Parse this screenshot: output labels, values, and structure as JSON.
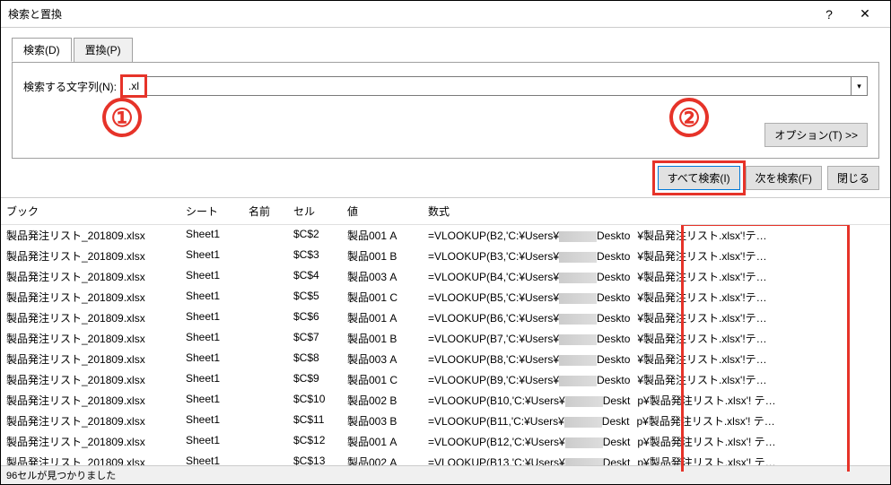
{
  "title": "検索と置換",
  "help_icon": "?",
  "close_icon": "✕",
  "tabs": {
    "find": "検索(D)",
    "replace": "置換(P)"
  },
  "search_label": "検索する文字列(N):",
  "search_value": ".xl",
  "options_button": "オプション(T) >>",
  "buttons": {
    "find_all": "すべて検索(I)",
    "find_next": "次を検索(F)",
    "close": "閉じる"
  },
  "columns": {
    "book": "ブック",
    "sheet": "シート",
    "name": "名前",
    "cell": "セル",
    "value": "値",
    "formula": "数式"
  },
  "rows": [
    {
      "book": "製品発注リスト_201809.xlsx",
      "sheet": "Sheet1",
      "cell": "$C$2",
      "value": "製品001 A",
      "formula_prefix": "=VLOOKUP(B2,'C:¥Users¥",
      "formula_mid": "Deskto",
      "formula_suffix": "¥製品発注リスト.xlsx'!テ…"
    },
    {
      "book": "製品発注リスト_201809.xlsx",
      "sheet": "Sheet1",
      "cell": "$C$3",
      "value": "製品001 B",
      "formula_prefix": "=VLOOKUP(B3,'C:¥Users¥",
      "formula_mid": "Deskto",
      "formula_suffix": "¥製品発注リスト.xlsx'!テ…"
    },
    {
      "book": "製品発注リスト_201809.xlsx",
      "sheet": "Sheet1",
      "cell": "$C$4",
      "value": "製品003 A",
      "formula_prefix": "=VLOOKUP(B4,'C:¥Users¥",
      "formula_mid": "Deskto",
      "formula_suffix": "¥製品発注リスト.xlsx'!テ…"
    },
    {
      "book": "製品発注リスト_201809.xlsx",
      "sheet": "Sheet1",
      "cell": "$C$5",
      "value": "製品001 C",
      "formula_prefix": "=VLOOKUP(B5,'C:¥Users¥",
      "formula_mid": "Deskto",
      "formula_suffix": "¥製品発注リスト.xlsx'!テ…"
    },
    {
      "book": "製品発注リスト_201809.xlsx",
      "sheet": "Sheet1",
      "cell": "$C$6",
      "value": "製品001 A",
      "formula_prefix": "=VLOOKUP(B6,'C:¥Users¥",
      "formula_mid": "Deskto",
      "formula_suffix": "¥製品発注リスト.xlsx'!テ…"
    },
    {
      "book": "製品発注リスト_201809.xlsx",
      "sheet": "Sheet1",
      "cell": "$C$7",
      "value": "製品001 B",
      "formula_prefix": "=VLOOKUP(B7,'C:¥Users¥",
      "formula_mid": "Deskto",
      "formula_suffix": "¥製品発注リスト.xlsx'!テ…"
    },
    {
      "book": "製品発注リスト_201809.xlsx",
      "sheet": "Sheet1",
      "cell": "$C$8",
      "value": "製品003 A",
      "formula_prefix": "=VLOOKUP(B8,'C:¥Users¥",
      "formula_mid": "Deskto",
      "formula_suffix": "¥製品発注リスト.xlsx'!テ…"
    },
    {
      "book": "製品発注リスト_201809.xlsx",
      "sheet": "Sheet1",
      "cell": "$C$9",
      "value": "製品001 C",
      "formula_prefix": "=VLOOKUP(B9,'C:¥Users¥",
      "formula_mid": "Deskto",
      "formula_suffix": "¥製品発注リスト.xlsx'!テ…"
    },
    {
      "book": "製品発注リスト_201809.xlsx",
      "sheet": "Sheet1",
      "cell": "$C$10",
      "value": "製品002 B",
      "formula_prefix": "=VLOOKUP(B10,'C:¥Users¥",
      "formula_mid": "Deskt",
      "formula_suffix": "p¥製品発注リスト.xlsx'! テ…"
    },
    {
      "book": "製品発注リスト_201809.xlsx",
      "sheet": "Sheet1",
      "cell": "$C$11",
      "value": "製品003 B",
      "formula_prefix": "=VLOOKUP(B11,'C:¥Users¥",
      "formula_mid": "Deskt",
      "formula_suffix": "p¥製品発注リスト.xlsx'! テ…"
    },
    {
      "book": "製品発注リスト_201809.xlsx",
      "sheet": "Sheet1",
      "cell": "$C$12",
      "value": "製品001 A",
      "formula_prefix": "=VLOOKUP(B12,'C:¥Users¥",
      "formula_mid": "Deskt",
      "formula_suffix": "p¥製品発注リスト.xlsx'! テ…"
    },
    {
      "book": "製品発注リスト_201809.xlsx",
      "sheet": "Sheet1",
      "cell": "$C$13",
      "value": "製品002 A",
      "formula_prefix": "=VLOOKUP(B13,'C:¥Users¥",
      "formula_mid": "Deskt",
      "formula_suffix": "p¥製品発注リスト.xlsx'! テ…"
    }
  ],
  "status": "96セルが見つかりました",
  "annotations": {
    "circle1": "①",
    "circle2": "②"
  }
}
